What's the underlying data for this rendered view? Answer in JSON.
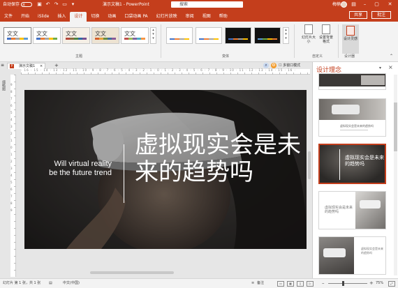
{
  "titlebar": {
    "autosave_label": "自动保存",
    "autosave_state": "关",
    "title": "演示文稿1 - PowerPoint",
    "search_placeholder": "搜索",
    "user_name": "梅楠"
  },
  "menubar": {
    "tabs": [
      "文件",
      "开始",
      "iSlide",
      "插入",
      "设计",
      "切换",
      "动画",
      "口袋动画 PA",
      "幻灯片放映",
      "审阅",
      "视图",
      "帮助"
    ],
    "active_tab": "设计",
    "share_label": "共享",
    "comment_label": "批注"
  },
  "ribbon": {
    "theme_sample_text": "文文",
    "group_theme_label": "主题",
    "group_variant_label": "变体",
    "group_customize_label": "自定义",
    "group_designer_label": "设计器",
    "slide_size_label": "幻灯片大小",
    "format_bg_label": "设置背景格式",
    "design_ideas_label": "设计灵感",
    "colors": {
      "accent": "#c43e1c",
      "ribbon_bg": "#f3f3f3"
    }
  },
  "doc_tabs": {
    "tab_label": "演示文稿1",
    "multi_window_label": "多窗口模式"
  },
  "ruler": {
    "horizontal_numbers": "· 16 · 15 · 14 · 13 · 12 · 11 · 10 · 9 · 8 · 7 · 6 · 5 · 4 · 3 · 2 · 1 · 0 · 1 · 2 · 3 · 4 · 5 · 6 · 7 · 8 · 9 · 10 · 11 · 12 · 13 · 14 · 15 · 16 ·",
    "vertical_numbers": "9876543210123456789"
  },
  "left_strip": {
    "thumbnails_label": "缩略图"
  },
  "slide": {
    "english_title": "Will virtual reality be the future trend",
    "chinese_title": "虚拟现实会是未来的趋势吗"
  },
  "design_pane": {
    "title": "设计理念",
    "ideas": [
      {
        "text": ""
      },
      {
        "text": "虚拟现实会是未来的趋势吗"
      },
      {
        "text": "虚拟现实会是未来的趋势吗",
        "selected": true
      },
      {
        "text": "虚拟现实会是未来的趋势吗"
      },
      {
        "text": "虚拟现实会是未来的趋势吗"
      }
    ]
  },
  "statusbar": {
    "slide_info": "幻灯片 第 1 张，共 1 张",
    "language": "中文(中国)",
    "notes_label": "备注",
    "zoom_label": "75%",
    "zoom_level": 0.75
  }
}
